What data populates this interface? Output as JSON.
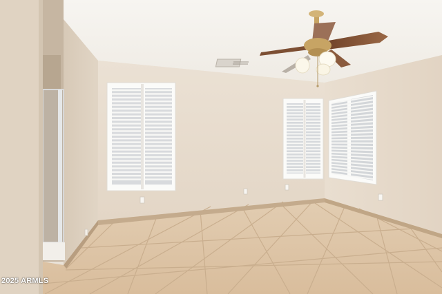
{
  "photo": {
    "watermark": "2025 ARMLS"
  },
  "colors": {
    "ceiling": "#f4f1ec",
    "back_wall": "#e8dccd",
    "right_wall": "#e6d9c9",
    "left_wall": "#ddd0bf",
    "floor_tile": "#ddc4a6",
    "grout": "#c9ae8e",
    "baseboard": "#bfa68a",
    "shutter": "#fbfbf9",
    "fan_blade": "#8a5a3c",
    "fan_brass": "#c7a464"
  }
}
